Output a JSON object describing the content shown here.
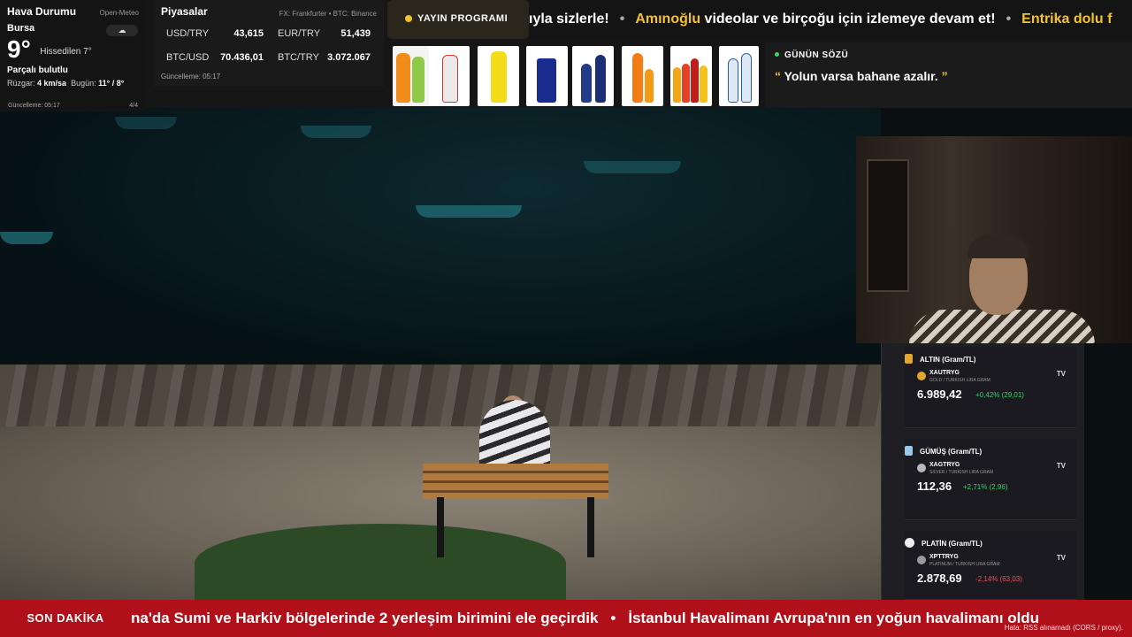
{
  "weather": {
    "title": "Hava Durumu",
    "source": "Open-Meteo",
    "city": "Bursa",
    "temp": "9°",
    "feels": "Hissedilen 7°",
    "condition": "Parçalı bulutlu",
    "wind_label": "Rüzgar:",
    "wind_value": "4 km/sa",
    "today_label": "Bugün:",
    "today_value": "11° / 8°",
    "updated": "Güncelleme: 05:17",
    "page": "4/4",
    "icon": "cloud-icon"
  },
  "markets": {
    "title": "Piyasalar",
    "source": "FX: Frankfurter • BTC: Binance",
    "rows": [
      {
        "label": "USD/TRY",
        "value": "43,615"
      },
      {
        "label": "EUR/TRY",
        "value": "51,439"
      },
      {
        "label": "BTC/USD",
        "value": "70.436,01"
      },
      {
        "label": "BTC/TRY",
        "value": "3.072.067"
      }
    ],
    "updated": "Güncelleme: 05:17"
  },
  "program_button": {
    "label": "YAYIN PROGRAMI"
  },
  "top_ticker": {
    "seg1": "ıyla sizlerle!",
    "seg2_hl": "Amınoğlu",
    "seg2": " videolar ve birçoğu için izlemeye devam et!",
    "seg3_hl": "Entrika dolu ",
    "seg3": "f"
  },
  "quote": {
    "header": "GÜNÜN SÖZÜ",
    "open": "“",
    "text": " Yolun varsa bahane azalır. ",
    "close": "”"
  },
  "metals": [
    {
      "title": "ALTIN (Gram/TL)",
      "ticker": "XAUTRYG",
      "sub": "GOLD / TURKISH LIRA GRAM",
      "price": "6.989,42",
      "change": "+0,42% (29,01)",
      "dir": "up",
      "color": "#e0a82e"
    },
    {
      "title": "GÜMÜŞ (Gram/TL)",
      "ticker": "XAGTRYG",
      "sub": "SILVER / TURKISH LIRA GRAM",
      "price": "112,36",
      "change": "+2,71% (2,96)",
      "dir": "up",
      "color": "#9bc7e8"
    },
    {
      "title": "PLATİN (Gram/TL)",
      "ticker": "XPTTRYG",
      "sub": "PLATINUM / TURKISH LIRA GRAM",
      "price": "2.878,69",
      "change": "-2,14% (63,03)",
      "dir": "down",
      "color": "#eeeeee"
    }
  ],
  "tv_label": "TV",
  "news": {
    "badge": "SON DAKİKA",
    "item1": "na'da Sumi ve Harkiv bölgelerinde 2 yerleşim birimini ele geçirdik",
    "item2": "İstanbul Havalimanı Avrupa'nın en yoğun havalimanı oldu",
    "error": "Hata: RSS alınamadı (CORS / proxy)."
  }
}
